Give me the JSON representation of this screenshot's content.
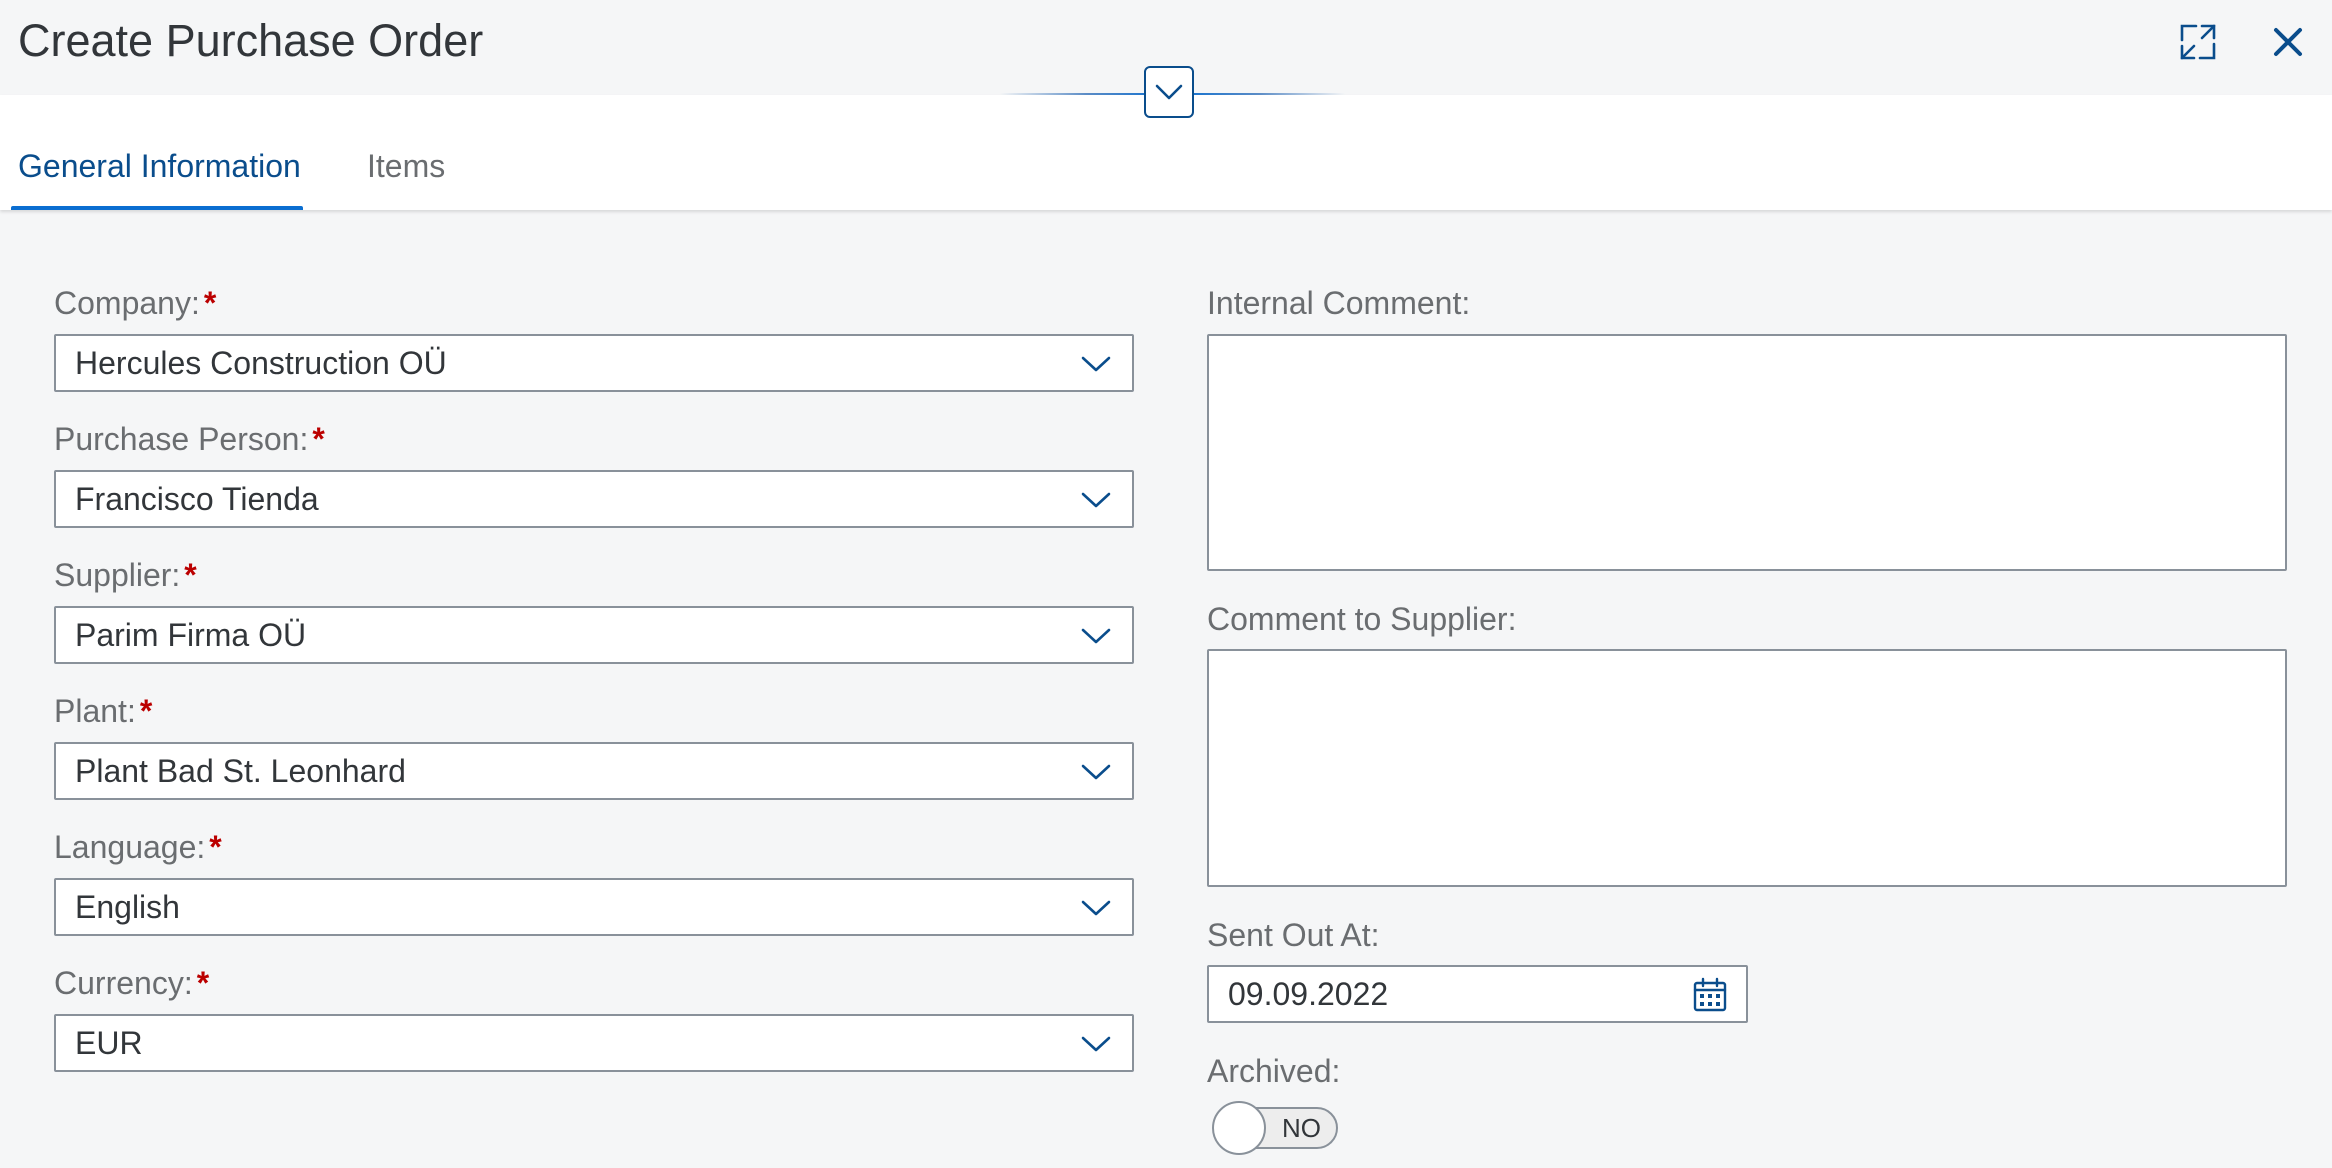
{
  "header": {
    "title": "Create Purchase Order",
    "icons": {
      "fullscreen": "fullscreen-icon",
      "close": "close-icon",
      "collapse": "chevron-down-icon"
    }
  },
  "tabs": [
    {
      "label": "General Information",
      "active": true
    },
    {
      "label": "Items",
      "active": false
    }
  ],
  "form": {
    "left": [
      {
        "label": "Company:",
        "required": "*",
        "value": "Hercules Construction OÜ"
      },
      {
        "label": "Purchase Person:",
        "required": "*",
        "value": "Francisco Tienda"
      },
      {
        "label": "Supplier:",
        "required": "*",
        "value": "Parim Firma OÜ"
      },
      {
        "label": "Plant:",
        "required": "*",
        "value": "Plant Bad St. Leonhard"
      },
      {
        "label": "Language:",
        "required": "*",
        "value": "English"
      },
      {
        "label": "Currency:",
        "required": "*",
        "value": "EUR"
      }
    ],
    "right": {
      "internal_comment": {
        "label": "Internal Comment:",
        "value": ""
      },
      "comment_to_supplier": {
        "label": "Comment to Supplier:",
        "value": ""
      },
      "sent_out_at": {
        "label": "Sent Out At:",
        "value": "09.09.2022",
        "icon": "calendar-icon"
      },
      "archived": {
        "label": "Archived:",
        "state_text": "NO",
        "on": false
      }
    }
  },
  "colors": {
    "accent": "#0a6ed1",
    "accent_dark": "#0a4d8c",
    "required": "#bb0000",
    "label": "#6a6d70",
    "text": "#32363a",
    "border": "#89919a",
    "background": "#f5f6f7"
  }
}
